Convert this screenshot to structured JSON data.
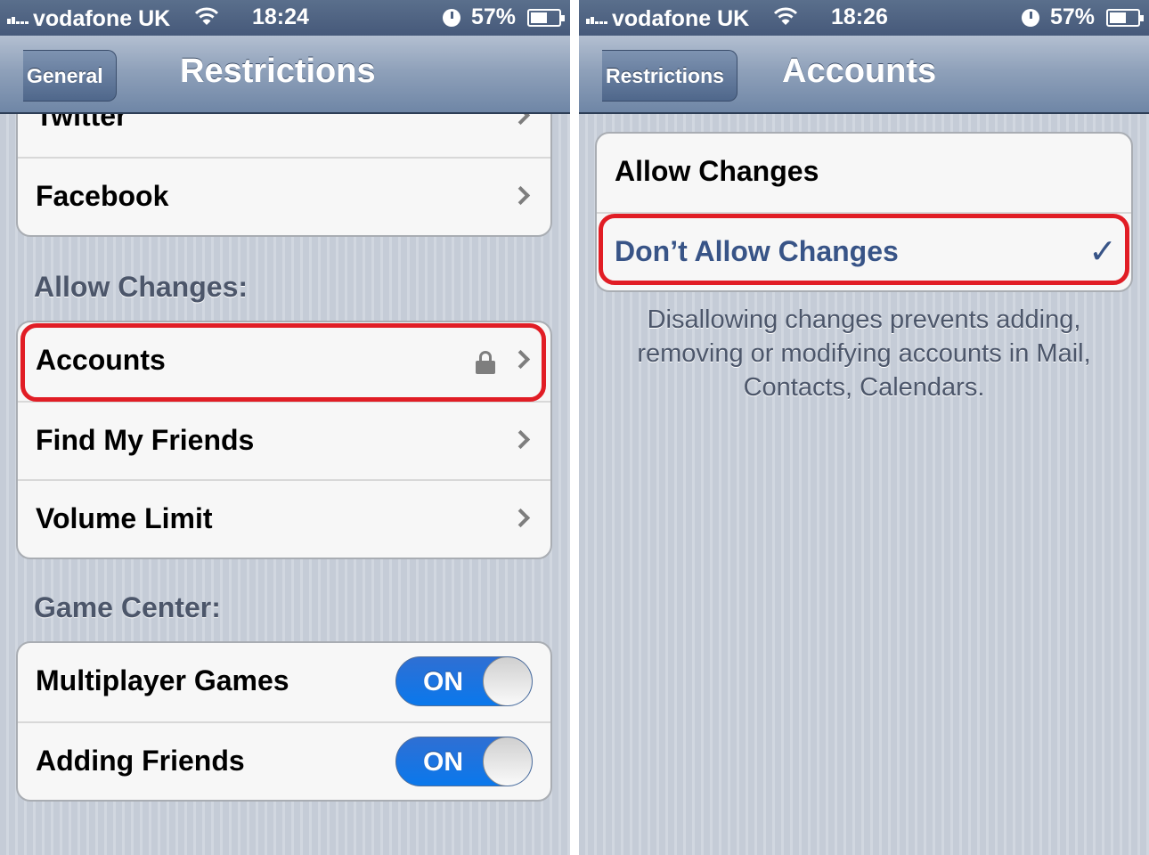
{
  "left": {
    "status": {
      "carrier": "vodafone UK",
      "time": "18:24",
      "battery": "57%"
    },
    "nav": {
      "back_label": "General",
      "title": "Restrictions"
    },
    "top_group": [
      {
        "label": "Twitter"
      },
      {
        "label": "Facebook"
      }
    ],
    "allow_changes": {
      "header": "Allow Changes:",
      "items": [
        {
          "label": "Accounts",
          "icon": "lock-icon"
        },
        {
          "label": "Find My Friends"
        },
        {
          "label": "Volume Limit"
        }
      ]
    },
    "game_center": {
      "header": "Game Center:",
      "items": [
        {
          "label": "Multiplayer Games",
          "toggle": "ON"
        },
        {
          "label": "Adding Friends",
          "toggle": "ON"
        }
      ]
    }
  },
  "right": {
    "status": {
      "carrier": "vodafone UK",
      "time": "18:26",
      "battery": "57%"
    },
    "nav": {
      "back_label": "Restrictions",
      "title": "Accounts"
    },
    "options": [
      {
        "label": "Allow Changes",
        "selected": false
      },
      {
        "label": "Don’t Allow Changes",
        "selected": true,
        "check": "✓"
      }
    ],
    "footer": "Disallowing changes prevents adding, removing or modifying accounts in Mail, Contacts, Calendars."
  },
  "colors": {
    "highlight": "#e11d25",
    "selected_text": "#385487",
    "toggle_on": "#0a78ec"
  }
}
